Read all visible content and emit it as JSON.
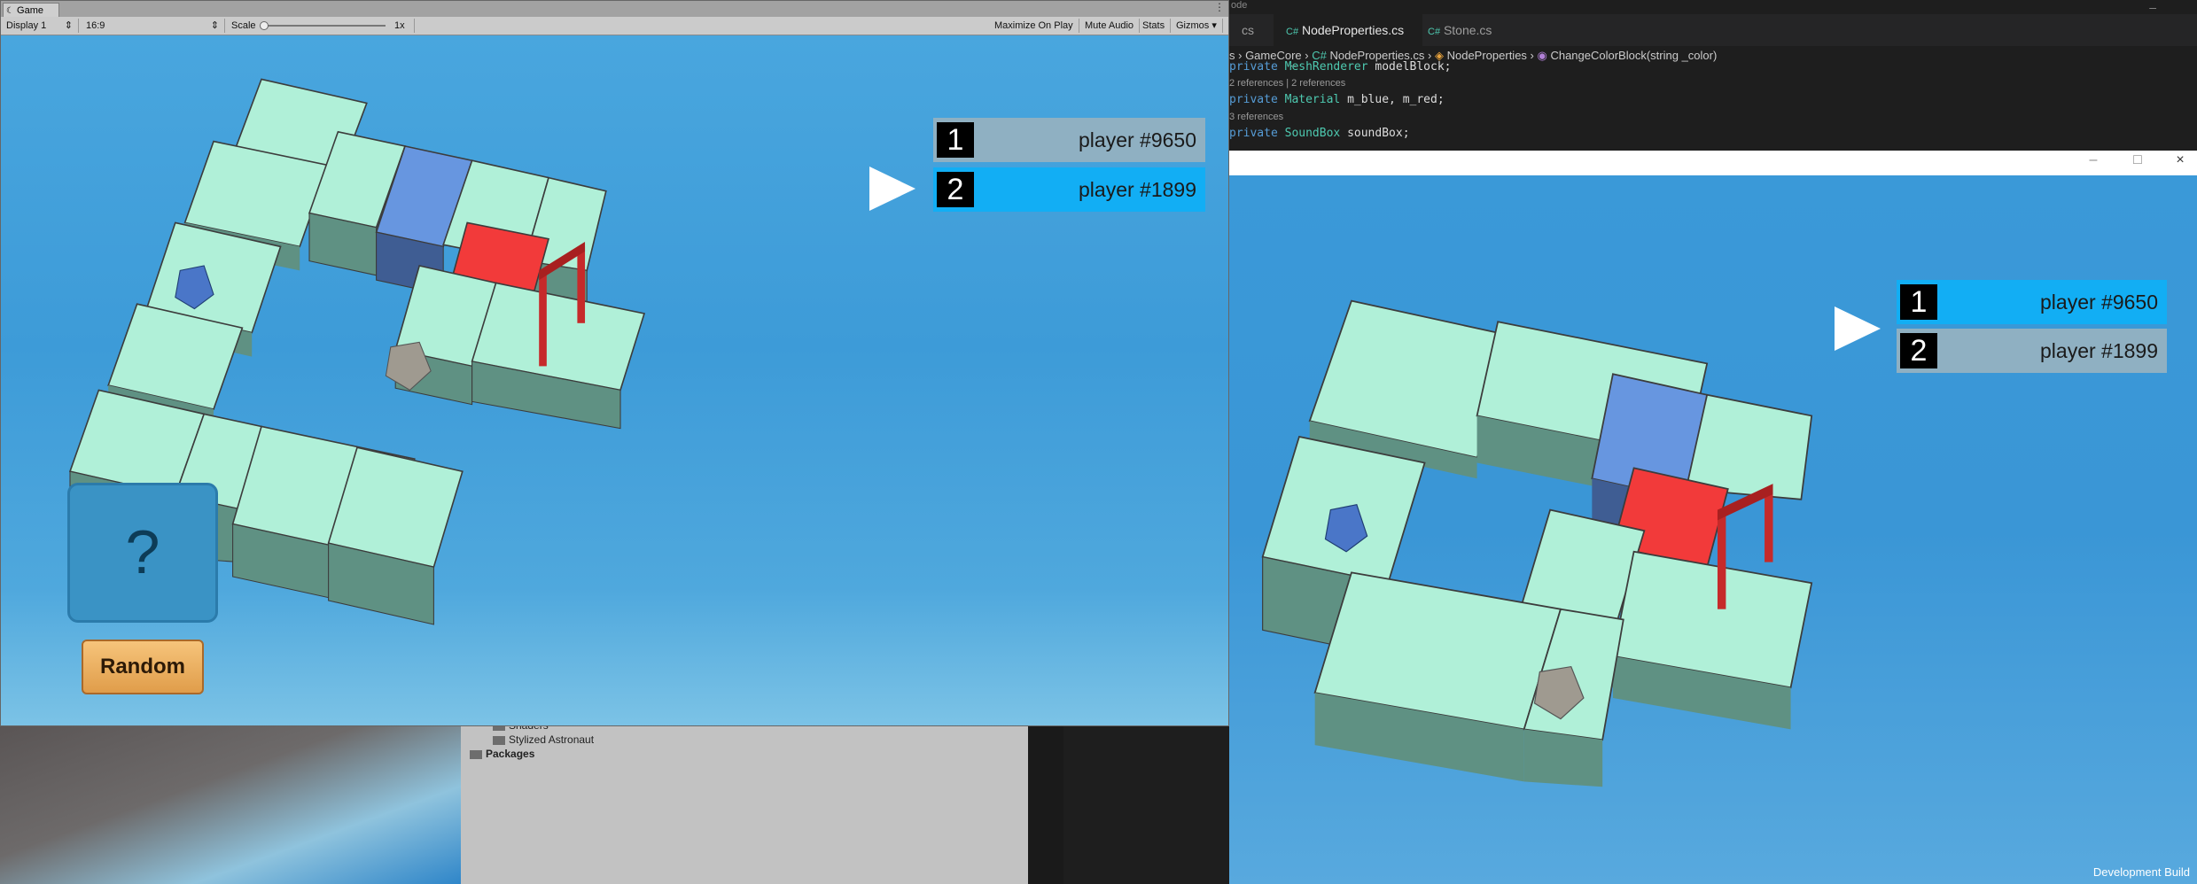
{
  "editor_background": {
    "project_tree": [
      "Shaders",
      "Stylized Astronaut",
      "Packages"
    ]
  },
  "code_editor": {
    "title_fragment": "ode",
    "tabs": [
      {
        "label": "cs",
        "active": false
      },
      {
        "label": "NodeProperties.cs",
        "active": true,
        "close": "×"
      },
      {
        "label": "Stone.cs",
        "active": false
      }
    ],
    "breadcrumb": [
      "s",
      "GameCore",
      "NodeProperties.cs",
      "NodeProperties",
      "ChangeColorBlock(string _color)"
    ],
    "lines": [
      {
        "kw": "private",
        "type": "MeshRenderer",
        "rest": " modelBlock;"
      },
      {
        "codelens": "2 references | 2 references"
      },
      {
        "kw": "private",
        "type": "Material",
        "rest": " m_blue, m_red;"
      },
      {
        "codelens": "3 references"
      },
      {
        "kw": "private",
        "type": "SoundBox",
        "rest": " soundBox;"
      }
    ],
    "window_controls": [
      "–",
      "□",
      "×"
    ]
  },
  "unity_game_window": {
    "tab_label": "Game",
    "toolbar": {
      "display": "Display 1",
      "aspect": "16:9",
      "scale_label": "Scale",
      "scale_value": "1x",
      "maximize_on_play": "Maximize On Play",
      "mute_audio": "Mute Audio",
      "stats": "Stats",
      "gizmos": "Gizmos"
    },
    "scoreboard": [
      {
        "number": "1",
        "name": "player #9650",
        "active": false
      },
      {
        "number": "2",
        "name": "player #1899",
        "active": true
      }
    ],
    "question_button": "?",
    "random_button": "Random"
  },
  "dev_build_window": {
    "window_controls": [
      "–",
      "□",
      "×"
    ],
    "scoreboard": [
      {
        "number": "1",
        "name": "player #9650",
        "active": true
      },
      {
        "number": "2",
        "name": "player #1899",
        "active": false
      }
    ],
    "footer_label": "Development Build"
  },
  "colors": {
    "active_row": "#12aef4",
    "inactive_row": "#8fb0c2",
    "tile": "#b0f0d8",
    "tile_side": "#5f9183",
    "blue_tile": "#6796e0",
    "red_tile": "#f23a3a",
    "sky": "#3d9bd8"
  }
}
